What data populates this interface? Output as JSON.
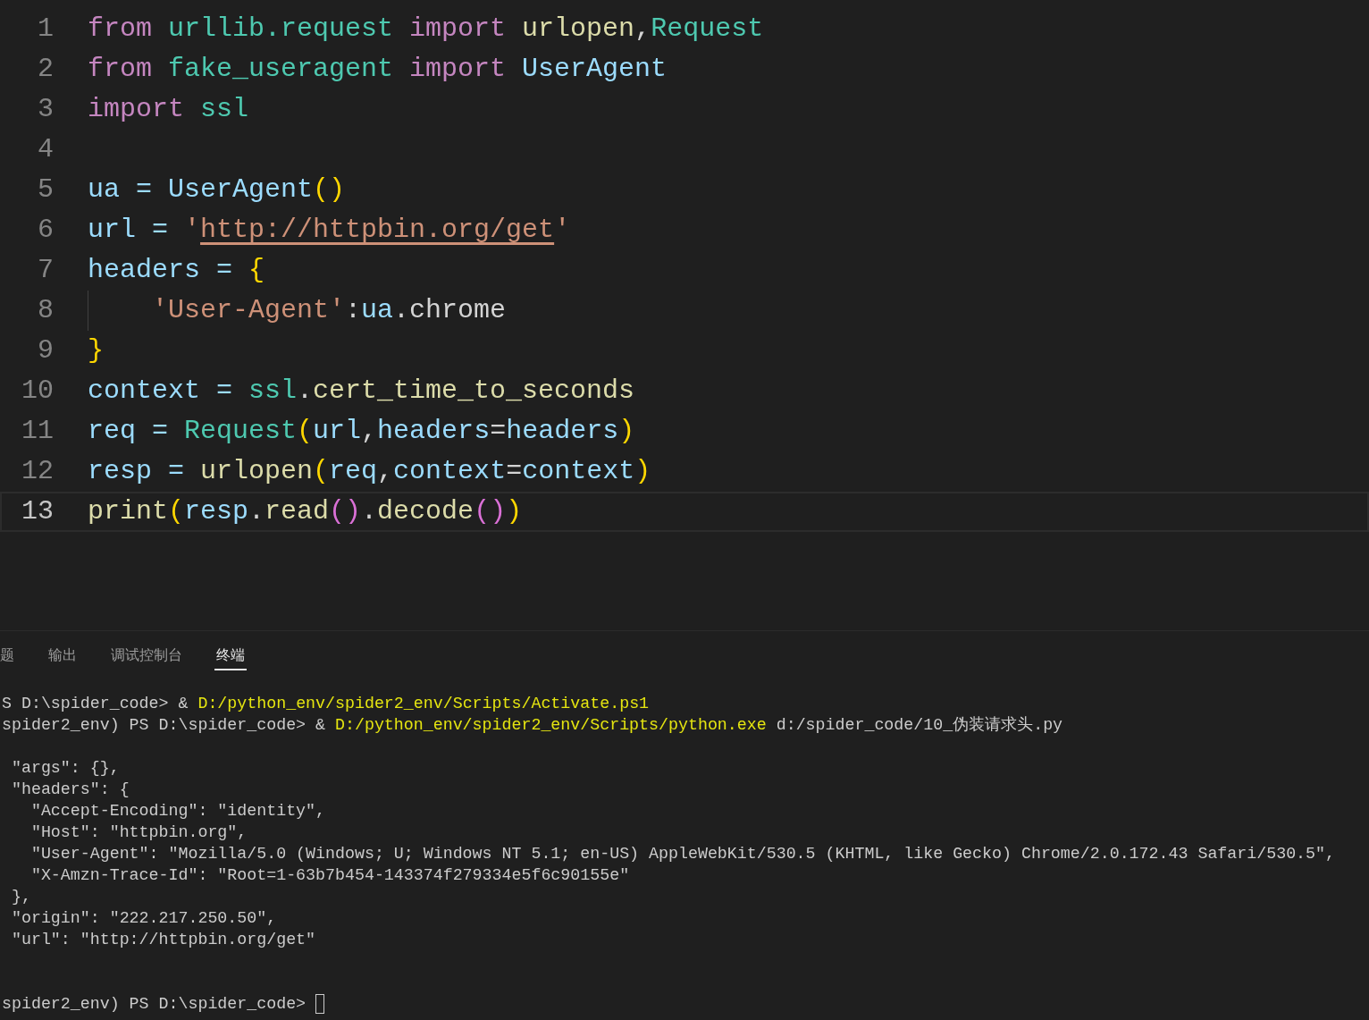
{
  "editor": {
    "lines": [
      {
        "number": "1",
        "current": false,
        "tokens": [
          {
            "text": "from ",
            "kind": "keyword"
          },
          {
            "text": "urllib.request ",
            "kind": "module"
          },
          {
            "text": "import ",
            "kind": "keyword"
          },
          {
            "text": "urlopen",
            "kind": "func"
          },
          {
            "text": ",",
            "kind": "plain"
          },
          {
            "text": "Request",
            "kind": "module"
          }
        ]
      },
      {
        "number": "2",
        "current": false,
        "tokens": [
          {
            "text": "from ",
            "kind": "keyword"
          },
          {
            "text": "fake_useragent ",
            "kind": "module"
          },
          {
            "text": "import ",
            "kind": "keyword"
          },
          {
            "text": "UserAgent",
            "kind": "var"
          }
        ]
      },
      {
        "number": "3",
        "current": false,
        "tokens": [
          {
            "text": "import ",
            "kind": "keyword"
          },
          {
            "text": "ssl",
            "kind": "module"
          }
        ]
      },
      {
        "number": "4",
        "current": false
      },
      {
        "number": "5",
        "current": false,
        "tokens": [
          {
            "text": "ua = ",
            "kind": "var"
          },
          {
            "text": "UserAgent",
            "kind": "var"
          },
          {
            "text": "()",
            "kind": "bracket1"
          }
        ]
      },
      {
        "number": "6",
        "current": false,
        "tokens": [
          {
            "text": "url = ",
            "kind": "var"
          },
          {
            "text": "'",
            "kind": "string"
          },
          {
            "text": "http://httpbin.org/get",
            "kind": "link"
          },
          {
            "text": "'",
            "kind": "string"
          }
        ]
      },
      {
        "number": "7",
        "current": false,
        "tokens": [
          {
            "text": "headers = ",
            "kind": "var"
          },
          {
            "text": "{",
            "kind": "bracket1"
          }
        ]
      },
      {
        "number": "8",
        "current": false,
        "indent": true,
        "tokens": [
          {
            "text": "'User-Agent'",
            "kind": "string"
          },
          {
            "text": ":",
            "kind": "plain"
          },
          {
            "text": "ua",
            "kind": "var"
          },
          {
            "text": ".chrome",
            "kind": "plain"
          }
        ]
      },
      {
        "number": "9",
        "current": false,
        "tokens": [
          {
            "text": "}",
            "kind": "bracket1"
          }
        ]
      },
      {
        "number": "10",
        "current": false,
        "tokens": [
          {
            "text": "context = ",
            "kind": "var"
          },
          {
            "text": "ssl",
            "kind": "module"
          },
          {
            "text": ".",
            "kind": "plain"
          },
          {
            "text": "cert_time_to_seconds",
            "kind": "func"
          }
        ]
      },
      {
        "number": "11",
        "current": false,
        "tokens": [
          {
            "text": "req = ",
            "kind": "var"
          },
          {
            "text": "Request",
            "kind": "module"
          },
          {
            "text": "(",
            "kind": "bracket1"
          },
          {
            "text": "url",
            "kind": "var"
          },
          {
            "text": ",",
            "kind": "plain"
          },
          {
            "text": "headers",
            "kind": "var"
          },
          {
            "text": "=",
            "kind": "plain"
          },
          {
            "text": "headers",
            "kind": "var"
          },
          {
            "text": ")",
            "kind": "bracket1"
          }
        ]
      },
      {
        "number": "12",
        "current": false,
        "tokens": [
          {
            "text": "resp = ",
            "kind": "var"
          },
          {
            "text": "urlopen",
            "kind": "func"
          },
          {
            "text": "(",
            "kind": "bracket1"
          },
          {
            "text": "req",
            "kind": "var"
          },
          {
            "text": ",",
            "kind": "plain"
          },
          {
            "text": "context",
            "kind": "var"
          },
          {
            "text": "=",
            "kind": "plain"
          },
          {
            "text": "context",
            "kind": "var"
          },
          {
            "text": ")",
            "kind": "bracket1"
          }
        ]
      },
      {
        "number": "13",
        "current": true,
        "tokens": [
          {
            "text": "print",
            "kind": "func"
          },
          {
            "text": "(",
            "kind": "bracket1"
          },
          {
            "text": "resp",
            "kind": "var"
          },
          {
            "text": ".",
            "kind": "plain"
          },
          {
            "text": "read",
            "kind": "func"
          },
          {
            "text": "()",
            "kind": "bracket2"
          },
          {
            "text": ".",
            "kind": "plain"
          },
          {
            "text": "decode",
            "kind": "func"
          },
          {
            "text": "()",
            "kind": "bracket2"
          },
          {
            "text": ")",
            "kind": "bracket1"
          }
        ]
      }
    ]
  },
  "panel": {
    "tabs": [
      {
        "label": "题",
        "selected": false
      },
      {
        "label": "输出",
        "selected": false
      },
      {
        "label": "调试控制台",
        "selected": false
      },
      {
        "label": "终端",
        "selected": true
      }
    ],
    "terminal": [
      {
        "kind": "text",
        "segments": [
          {
            "text": "S D:\\spider_code> & ",
            "kind": "plain"
          },
          {
            "text": "D:/python_env/spider2_env/Scripts/Activate.ps1",
            "kind": "path"
          }
        ]
      },
      {
        "kind": "text",
        "segments": [
          {
            "text": "spider2_env) PS D:\\spider_code> & ",
            "kind": "plain"
          },
          {
            "text": "D:/python_env/spider2_env/Scripts/python.exe",
            "kind": "path"
          },
          {
            "text": " d:/spider_code/10_伪装请求头.py",
            "kind": "plain"
          }
        ]
      },
      {
        "kind": "blank"
      },
      {
        "kind": "text",
        "segments": [
          {
            "text": " \"args\": {},",
            "kind": "plain"
          }
        ]
      },
      {
        "kind": "text",
        "segments": [
          {
            "text": " \"headers\": {",
            "kind": "plain"
          }
        ]
      },
      {
        "kind": "text",
        "segments": [
          {
            "text": "   \"Accept-Encoding\": \"identity\",",
            "kind": "plain"
          }
        ]
      },
      {
        "kind": "text",
        "segments": [
          {
            "text": "   \"Host\": \"httpbin.org\",",
            "kind": "plain"
          }
        ]
      },
      {
        "kind": "text",
        "segments": [
          {
            "text": "   \"User-Agent\": \"Mozilla/5.0 (Windows; U; Windows NT 5.1; en-US) AppleWebKit/530.5 (KHTML, like Gecko) Chrome/2.0.172.43 Safari/530.5\",",
            "kind": "plain"
          }
        ]
      },
      {
        "kind": "text",
        "segments": [
          {
            "text": "   \"X-Amzn-Trace-Id\": \"Root=1-63b7b454-143374f279334e5f6c90155e\"",
            "kind": "plain"
          }
        ]
      },
      {
        "kind": "text",
        "segments": [
          {
            "text": " },",
            "kind": "plain"
          }
        ]
      },
      {
        "kind": "text",
        "segments": [
          {
            "text": " \"origin\": \"222.217.250.50\",",
            "kind": "plain"
          }
        ]
      },
      {
        "kind": "text",
        "segments": [
          {
            "text": " \"url\": \"http://httpbin.org/get\"",
            "kind": "plain"
          }
        ]
      },
      {
        "kind": "blank"
      },
      {
        "kind": "blank"
      },
      {
        "kind": "prompt",
        "segments": [
          {
            "text": "spider2_env) PS D:\\spider_code> ",
            "kind": "plain"
          }
        ]
      }
    ]
  }
}
